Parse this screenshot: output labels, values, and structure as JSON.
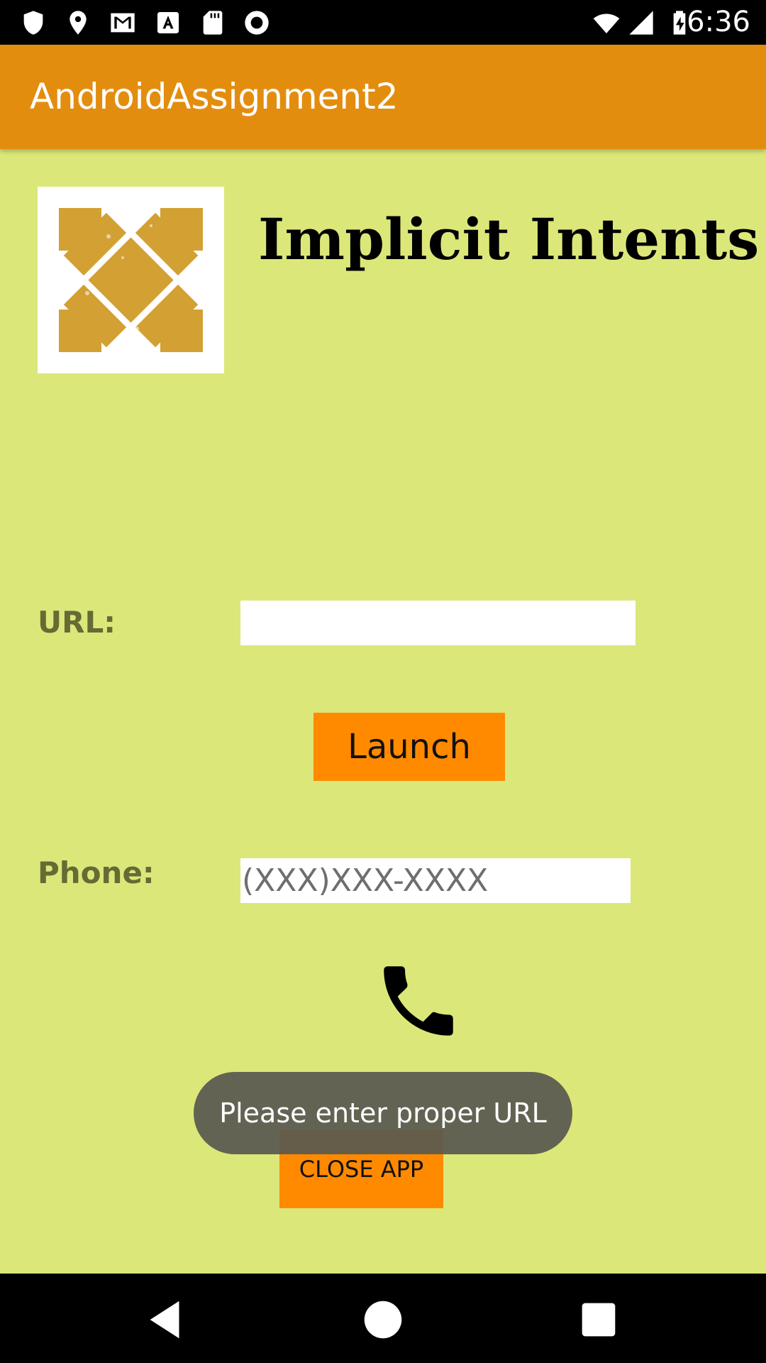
{
  "status_bar": {
    "time": "6:36",
    "left_icons": [
      "shield-icon",
      "location-pin-icon",
      "gmail-icon",
      "font-a-icon",
      "sd-card-icon",
      "record-icon"
    ],
    "right_icons": [
      "wifi-icon",
      "signal-icon",
      "battery-charging-icon"
    ]
  },
  "app_bar": {
    "title": "AndroidAssignment2",
    "color": "#e38d0f"
  },
  "content": {
    "heading": "Implicit Intents",
    "url_label": "URL:",
    "url_value": "",
    "launch_label": "Launch",
    "phone_label": "Phone:",
    "phone_placeholder": "(XXX)XXX-XXXX",
    "call_icon": "phone-icon",
    "close_label": "CLOSE APP"
  },
  "toast": {
    "message": "Please enter proper URL"
  },
  "nav_bar": {
    "buttons": [
      "back-icon",
      "home-icon",
      "recents-icon"
    ]
  },
  "colors": {
    "background": "#dce77a",
    "button": "#ff8a00",
    "label": "#666a33"
  }
}
